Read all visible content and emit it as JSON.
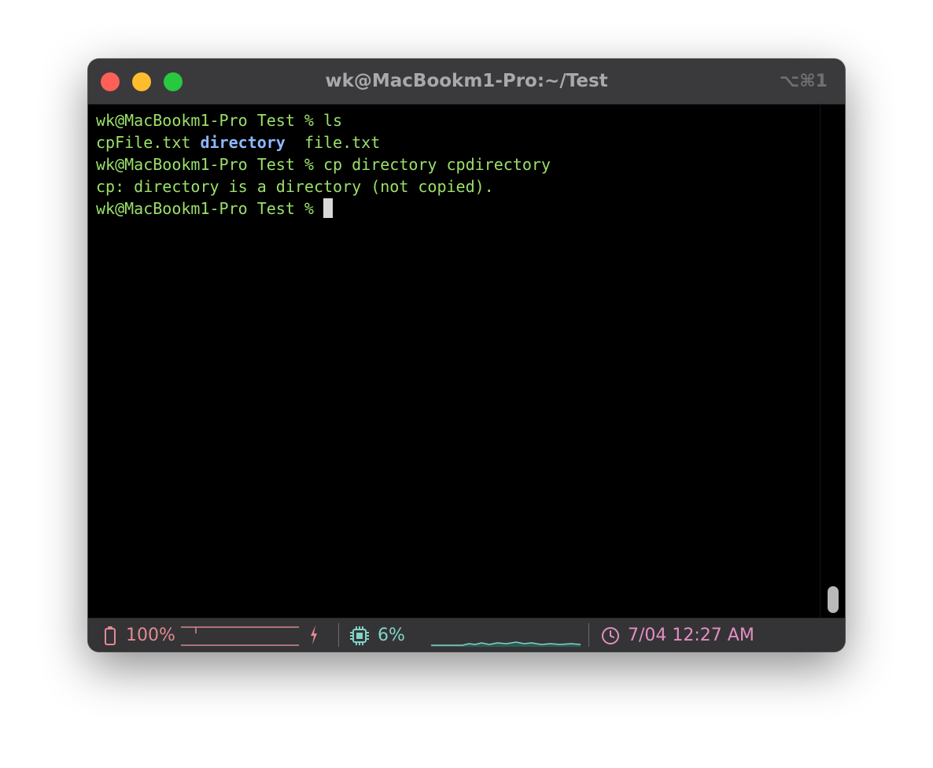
{
  "window": {
    "title": "wk@MacBookm1-Pro:~/Test",
    "shortcut": "⌥⌘1",
    "traffic_lights": {
      "close_color": "#fe5f57",
      "minimize_color": "#febc2e",
      "zoom_color": "#28c840"
    }
  },
  "terminal": {
    "lines": [
      {
        "prompt": "wk@MacBookm1-Pro Test % ",
        "command": "ls"
      },
      {
        "files": [
          "cpFile.txt",
          "directory",
          "file.txt"
        ],
        "file_sep_1": " ",
        "file_sep_2": "  "
      },
      {
        "prompt": "wk@MacBookm1-Pro Test % ",
        "command": "cp directory cpdirectory"
      },
      {
        "output": "cp: directory is a directory (not copied)."
      },
      {
        "prompt": "wk@MacBookm1-Pro Test % ",
        "command": ""
      }
    ],
    "colors": {
      "text": "#9be06a",
      "directory": "#8fb8ff",
      "cursor": "#d8d8d8"
    }
  },
  "statusbar": {
    "battery": {
      "percent_label": "100%",
      "level": 1.0,
      "icon": "battery-icon",
      "color": "#e28a93"
    },
    "charging": {
      "icon": "lightning-icon"
    },
    "cpu": {
      "percent_label": "6%",
      "level": 0.06,
      "icon": "cpu-chip-icon",
      "color": "#82d3c7"
    },
    "clock": {
      "time_label": "7/04 12:27 AM",
      "icon": "clock-icon",
      "color": "#e38fc2"
    }
  }
}
